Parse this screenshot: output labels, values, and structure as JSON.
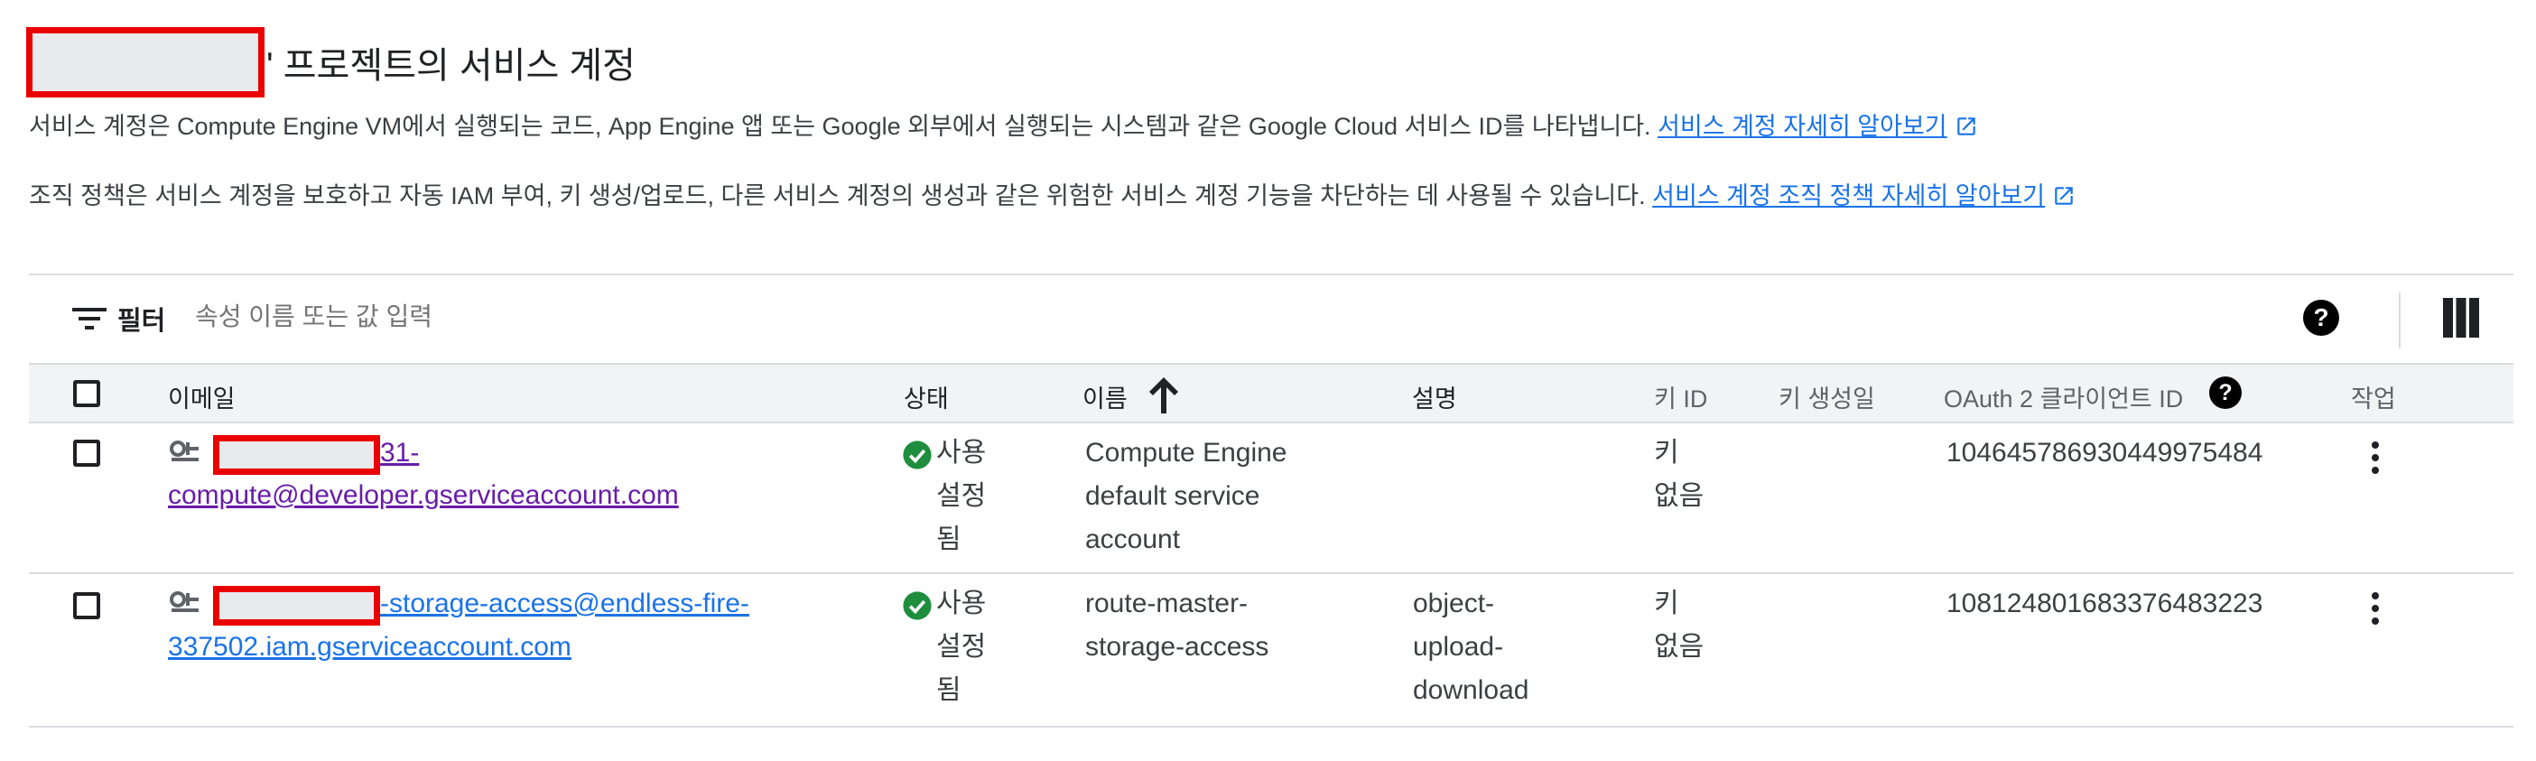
{
  "page": {
    "title": "' 프로젝트의 서비스 계정",
    "description1": "서비스 계정은 Compute Engine VM에서 실행되는 코드, App Engine 앱 또는 Google 외부에서 실행되는 시스템과 같은 Google Cloud 서비스 ID를 나타냅니다.",
    "description1_link": "서비스 계정 자세히 알아보기",
    "description2": "조직 정책은 서비스 계정을 보호하고 자동 IAM 부여, 키 생성/업로드, 다른 서비스 계정의 생성과 같은 위험한 서비스 계정 기능을 차단하는 데 사용될 수 있습니다.",
    "description2_link": "서비스 계정 조직 정책 자세히 알아보기"
  },
  "toolbar": {
    "filter_label": "필터",
    "filter_placeholder": "속성 이름 또는 값 입력",
    "help_icon": "help-circle-icon",
    "columns_icon": "column-display-icon"
  },
  "table": {
    "headers": {
      "email": "이메일",
      "status": "상태",
      "name": "이름",
      "description": "설명",
      "key_id": "키 ID",
      "key_created": "키 생성일",
      "oauth_client_id": "OAuth 2 클라이언트 ID",
      "actions": "작업"
    },
    "rows": [
      {
        "email_visible_part1": "31-",
        "email_visible_part2": "compute@developer.gserviceaccount.com",
        "status_line1": "사용",
        "status_line2": "설정",
        "status_line3": "됨",
        "name_line1": "Compute Engine",
        "name_line2": "default service",
        "name_line3": "account",
        "description_line1": "",
        "description_line2": "",
        "description_line3": "",
        "key_line1": "키",
        "key_line2": "없음",
        "oauth_client_id": "104645786930449975484"
      },
      {
        "email_visible_part1": "-storage-access@endless-fire-",
        "email_visible_part2": "337502.iam.gserviceaccount.com",
        "status_line1": "사용",
        "status_line2": "설정",
        "status_line3": "됨",
        "name_line1": "route-master-",
        "name_line2": "storage-access",
        "name_line3": "",
        "description_line1": "object-",
        "description_line2": "upload-",
        "description_line3": "download",
        "key_line1": "키",
        "key_line2": "없음",
        "oauth_client_id": "108124801683376483223"
      }
    ]
  },
  "colors": {
    "link": "#1a73e8",
    "visited_link": "#681da8",
    "status_ok": "#1e8e3e",
    "redaction_border": "#ea0000"
  }
}
